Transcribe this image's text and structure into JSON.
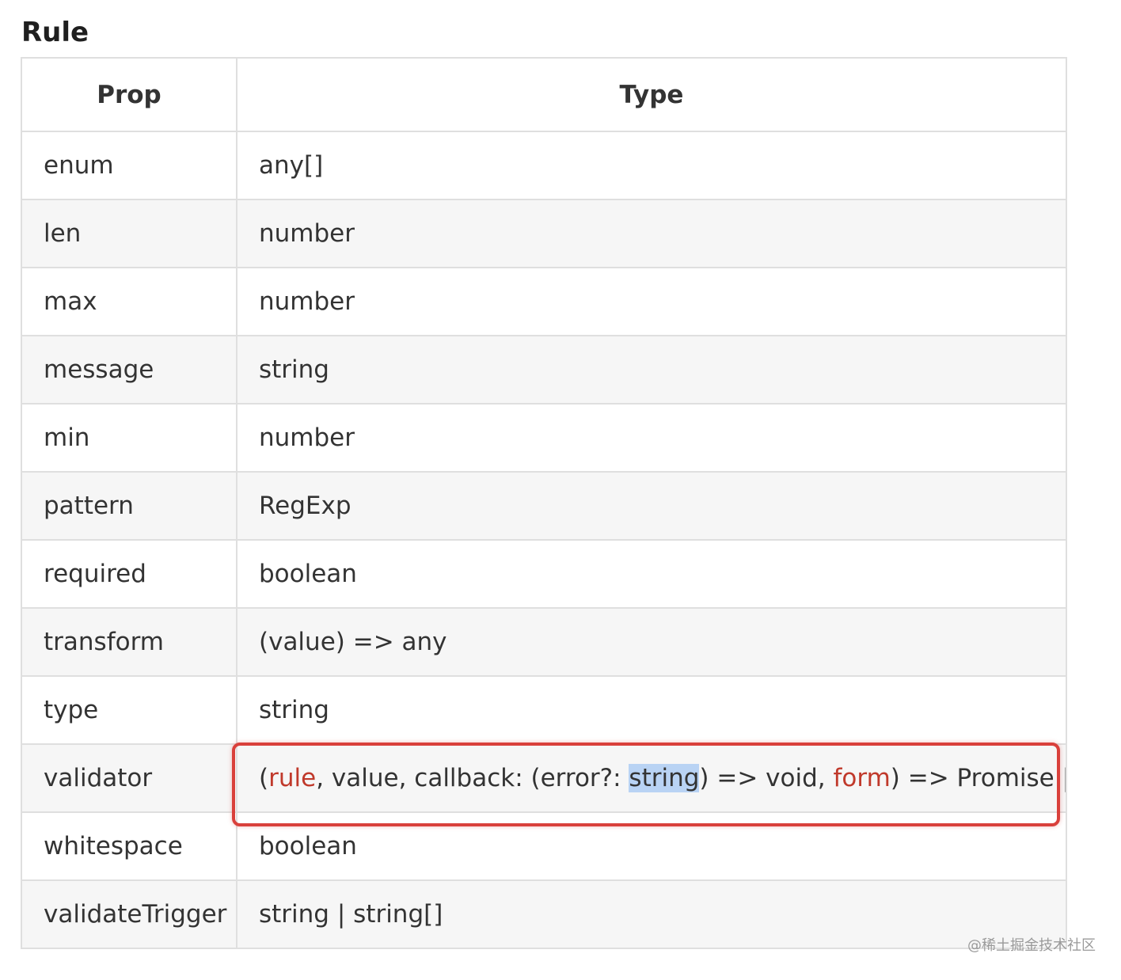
{
  "heading": "Rule",
  "table": {
    "headers": {
      "prop": "Prop",
      "type": "Type"
    },
    "rows": [
      {
        "prop": "enum",
        "type": "any[]"
      },
      {
        "prop": "len",
        "type": "number"
      },
      {
        "prop": "max",
        "type": "number"
      },
      {
        "prop": "message",
        "type": "string"
      },
      {
        "prop": "min",
        "type": "number"
      },
      {
        "prop": "pattern",
        "type": "RegExp"
      },
      {
        "prop": "required",
        "type": "boolean"
      },
      {
        "prop": "transform",
        "type": "(value) => any"
      },
      {
        "prop": "type",
        "type": "string"
      },
      {
        "prop": "validator",
        "type_parts": {
          "p1": "(",
          "rule": "rule",
          "p2": ", value, callback: (error?: ",
          "selected": "string",
          "p3": ") => void, ",
          "form": "form",
          "p4": ") => Promise | void"
        }
      },
      {
        "prop": "whitespace",
        "type": "boolean"
      },
      {
        "prop": "validateTrigger",
        "type": "string | string[]"
      }
    ]
  },
  "colors": {
    "highlight_red": "#c0392b",
    "callout_border": "#d9403b",
    "selection": "#b9d3f4"
  },
  "watermark": "@稀土掘金技术社区"
}
